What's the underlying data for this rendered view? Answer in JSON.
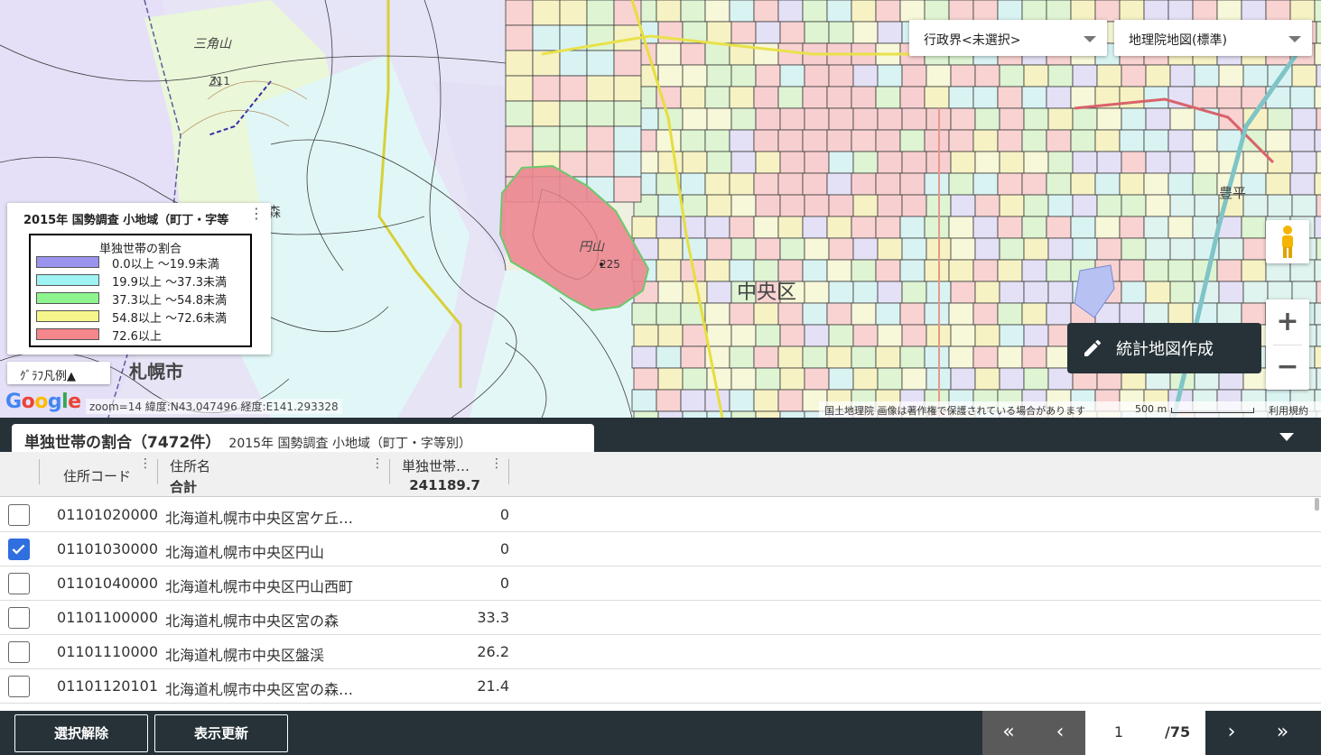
{
  "map": {
    "region_select": "行政界<未選択>",
    "basemap_select": "地理院地図(標準)",
    "legend": {
      "title": "2015年 国勢調査 小地域（町丁・字等",
      "box_title": "単独世帯の割合",
      "items": [
        {
          "label": "0.0以上 ～19.9未満",
          "color": "#9a94ee"
        },
        {
          "label": "19.9以上 ～37.3未満",
          "color": "#9ff3f3"
        },
        {
          "label": "37.3以上 ～54.8未満",
          "color": "#8ef58e"
        },
        {
          "label": "54.8以上 ～72.6未満",
          "color": "#f6f68c"
        },
        {
          "label": "72.6以上",
          "color": "#f5868c"
        }
      ]
    },
    "graph_legend_button": "ｸﾞﾗﾌ凡例▲",
    "labels": {
      "city": "札幌市",
      "ward": "中央区",
      "hill": "円山",
      "peak": "225",
      "sankaku": "三角山",
      "sankaku_elev": "311",
      "toyohira": "豊平",
      "mori": "森"
    },
    "zoom_info": "zoom=14  緯度:N43.047496  経度:E141.293328",
    "attribution": "国土地理院  画像は著作権で保護されている場合があります",
    "scale": "500 m",
    "terms": "利用規約",
    "make_map_button": "統計地図作成"
  },
  "panel": {
    "title": "単独世帯の割合（7472件）",
    "subtitle": "2015年 国勢調査 小地域（町丁・字等別）",
    "columns": {
      "code": "住所コード",
      "name": "住所名",
      "name_total": "合計",
      "value": "単独世帯…",
      "value_total": "241189.7"
    },
    "rows": [
      {
        "code": "01101020000",
        "name": "北海道札幌市中央区宮ケ丘…",
        "value": "0",
        "checked": false
      },
      {
        "code": "01101030000",
        "name": "北海道札幌市中央区円山",
        "value": "0",
        "checked": true
      },
      {
        "code": "01101040000",
        "name": "北海道札幌市中央区円山西町",
        "value": "0",
        "checked": false
      },
      {
        "code": "01101100000",
        "name": "北海道札幌市中央区宮の森",
        "value": "33.3",
        "checked": false
      },
      {
        "code": "01101110000",
        "name": "北海道札幌市中央区盤渓",
        "value": "26.2",
        "checked": false
      },
      {
        "code": "01101120101",
        "name": "北海道札幌市中央区宮の森…",
        "value": "21.4",
        "checked": false
      }
    ]
  },
  "footer": {
    "deselect": "選択解除",
    "refresh": "表示更新",
    "page_first": "«",
    "page_prev": "‹",
    "page_current": "1",
    "page_total": "/75",
    "page_next": "›",
    "page_last": "»"
  }
}
